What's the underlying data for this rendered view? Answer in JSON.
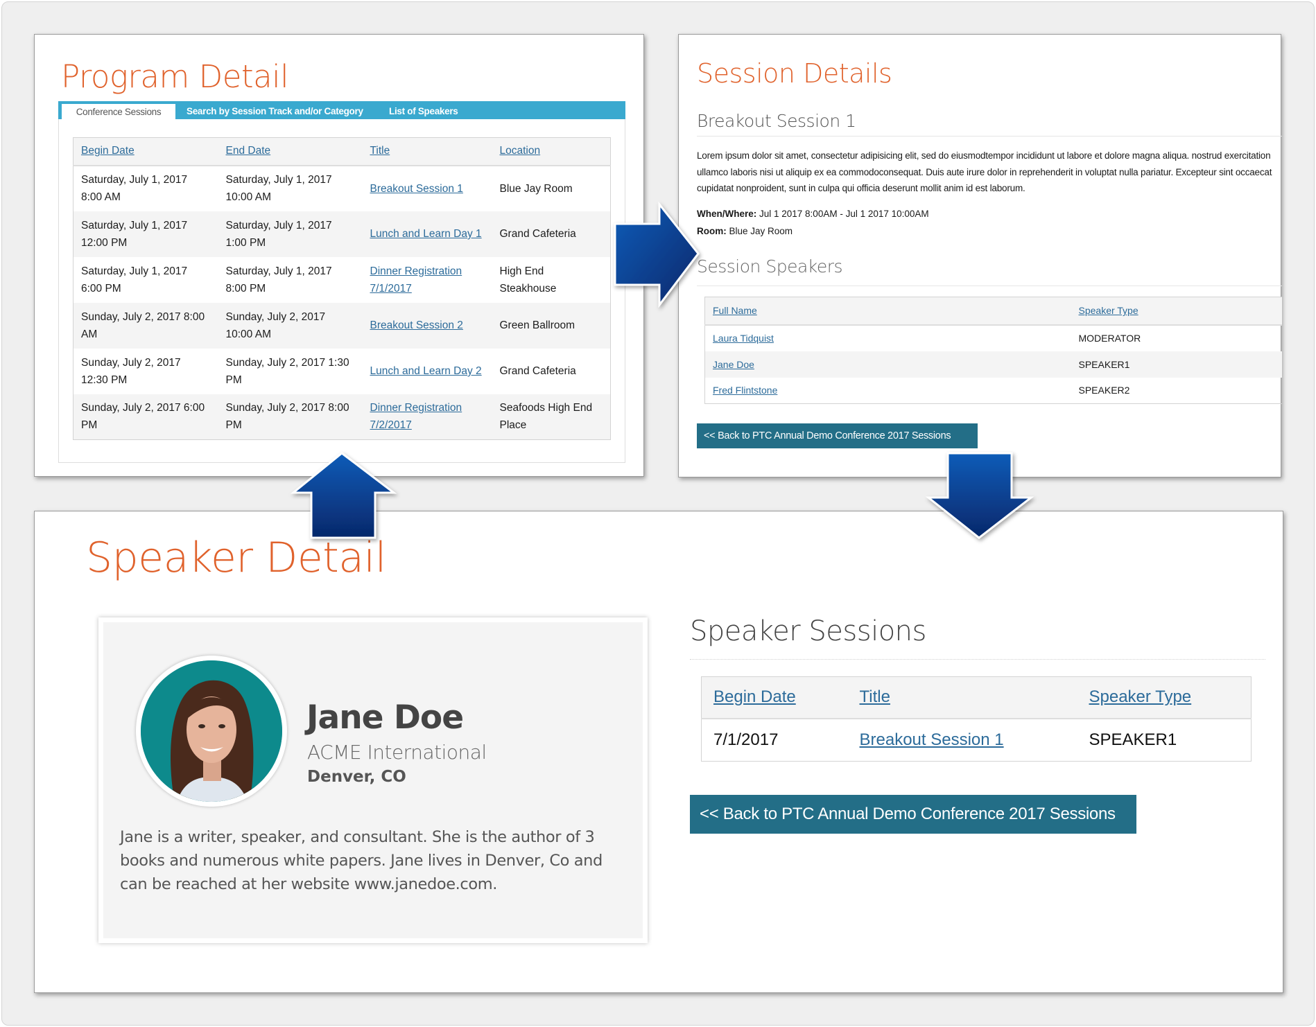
{
  "program_detail": {
    "title": "Program Detail",
    "tabs": [
      {
        "label": "Conference Sessions",
        "active": true
      },
      {
        "label": "Search by Session Track and/or Category",
        "active": false
      },
      {
        "label": "List of Speakers",
        "active": false
      }
    ],
    "table": {
      "headers": [
        "Begin Date",
        "End Date",
        "Title",
        "Location"
      ],
      "rows": [
        {
          "begin": "Saturday, July 1, 2017 8:00 AM",
          "end": "Saturday, July 1, 2017 10:00 AM",
          "title": "Breakout Session 1",
          "location": "Blue Jay Room"
        },
        {
          "begin": "Saturday, July 1, 2017 12:00 PM",
          "end": "Saturday, July 1, 2017 1:00 PM",
          "title": "Lunch and Learn Day 1",
          "location": "Grand Cafeteria"
        },
        {
          "begin": "Saturday, July 1, 2017 6:00 PM",
          "end": "Saturday, July 1, 2017 8:00 PM",
          "title": "Dinner Registration 7/1/2017",
          "location": "High End Steakhouse"
        },
        {
          "begin": "Sunday, July 2, 2017 8:00 AM",
          "end": "Sunday, July 2, 2017 10:00 AM",
          "title": "Breakout Session 2",
          "location": "Green Ballroom"
        },
        {
          "begin": "Sunday, July 2, 2017 12:30 PM",
          "end": "Sunday, July 2, 2017 1:30 PM",
          "title": "Lunch and Learn Day 2",
          "location": "Grand Cafeteria"
        },
        {
          "begin": "Sunday, July 2, 2017 6:00 PM",
          "end": "Sunday, July 2, 2017 8:00 PM",
          "title": "Dinner Registration 7/2/2017",
          "location": "Seafoods High End Place"
        }
      ]
    }
  },
  "session_details": {
    "title": "Session Details",
    "session_name": "Breakout Session 1",
    "description": "Lorem ipsum dolor sit amet, consectetur adipisicing elit, sed do eiusmodtempor incididunt ut labore et dolore magna aliqua. nostrud exercitation ullamco laboris nisi ut aliquip ex ea commodoconsequat. Duis aute irure dolor in reprehenderit in voluptat nulla pariatur. Excepteur sint occaecat cupidatat nonproident, sunt in culpa qui officia deserunt mollit anim id est laborum.",
    "when_where_label": "When/Where:",
    "when_where_value": " Jul 1 2017 8:00AM - Jul 1 2017 10:00AM",
    "room_label": "Room:",
    "room_value": " Blue Jay Room",
    "speakers_heading": "Session Speakers",
    "speakers_table": {
      "headers": [
        "Full Name",
        "Speaker Type"
      ],
      "rows": [
        {
          "name": "Laura Tidquist",
          "type": "MODERATOR"
        },
        {
          "name": "Jane Doe",
          "type": "SPEAKER1"
        },
        {
          "name": "Fred Flintstone",
          "type": "SPEAKER2"
        }
      ]
    },
    "back_button": "<< Back to PTC Annual Demo Conference 2017 Sessions"
  },
  "speaker_detail": {
    "title": "Speaker Detail",
    "name": "Jane Doe",
    "organization": "ACME International",
    "location": "Denver, CO",
    "bio": "Jane is a writer, speaker, and consultant. She is the author of 3 books and numerous white papers. Jane  lives in Denver, Co and can be reached at her website www.janedoe.com.",
    "sessions_heading": "Speaker Sessions",
    "sessions_table": {
      "headers": [
        "Begin Date",
        "Title",
        "Speaker Type"
      ],
      "rows": [
        {
          "begin": "7/1/2017",
          "title": "Breakout Session 1",
          "type": "SPEAKER1"
        }
      ]
    },
    "back_button": "<< Back to PTC Annual Demo Conference 2017 Sessions"
  },
  "colors": {
    "title_orange": "#e0622c",
    "tab_blue": "#3aa9cf",
    "link_blue": "#2c6b9a",
    "button_teal": "#236e87",
    "arrow_blue": "#0a4fa0",
    "avatar_bg": "#0d8a8c"
  }
}
